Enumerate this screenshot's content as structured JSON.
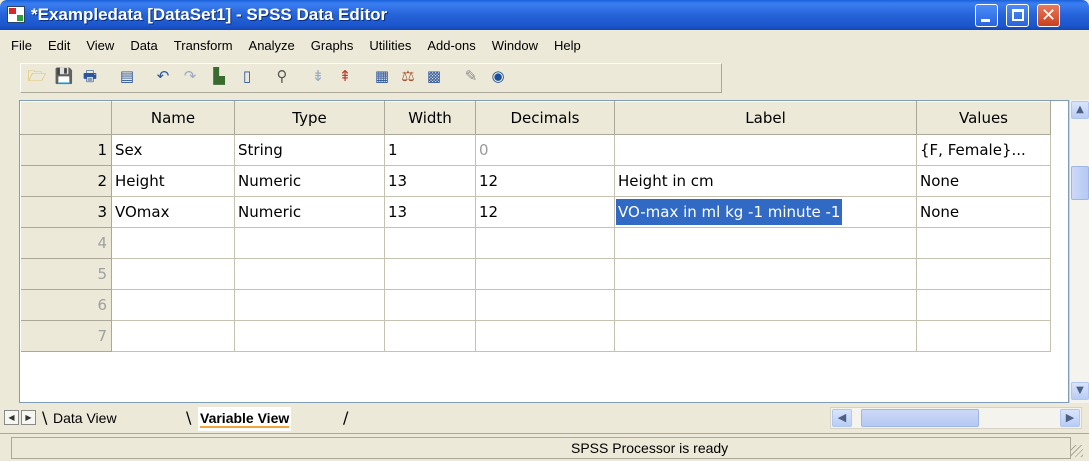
{
  "window": {
    "title": "*Exampledata [DataSet1] - SPSS Data Editor",
    "close_glyph": "✕"
  },
  "menu": [
    "File",
    "Edit",
    "View",
    "Data",
    "Transform",
    "Analyze",
    "Graphs",
    "Utilities",
    "Add-ons",
    "Window",
    "Help"
  ],
  "toolbar": {
    "icons": [
      {
        "name": "open-folder-icon",
        "glyph": "🗁"
      },
      {
        "name": "save-icon",
        "glyph": "💾"
      },
      {
        "name": "print-icon",
        "glyph": "🖶"
      },
      {
        "name": "dialog-recall-icon",
        "glyph": "▤"
      },
      {
        "name": "undo-icon",
        "glyph": "↶"
      },
      {
        "name": "redo-icon",
        "glyph": "↷"
      },
      {
        "name": "goto-case-icon",
        "glyph": "▙"
      },
      {
        "name": "variables-icon",
        "glyph": "▯"
      },
      {
        "name": "find-icon",
        "glyph": "⚲"
      },
      {
        "name": "insert-cases-icon",
        "glyph": "⇟"
      },
      {
        "name": "insert-variable-icon",
        "glyph": "⇞"
      },
      {
        "name": "split-file-icon",
        "glyph": "▦"
      },
      {
        "name": "weight-cases-icon",
        "glyph": "⚖"
      },
      {
        "name": "select-cases-icon",
        "glyph": "▩"
      },
      {
        "name": "value-labels-icon",
        "glyph": "✎"
      },
      {
        "name": "use-variable-sets-icon",
        "glyph": "◉"
      }
    ]
  },
  "grid": {
    "columns": [
      "Name",
      "Type",
      "Width",
      "Decimals",
      "Label",
      "Values"
    ],
    "rows": [
      {
        "num": "1",
        "name": "Sex",
        "type": "String",
        "width": "1",
        "decimals": "0",
        "label": "",
        "values": "{F, Female}..."
      },
      {
        "num": "2",
        "name": "Height",
        "type": "Numeric",
        "width": "13",
        "decimals": "12",
        "label": "Height in cm",
        "values": "None"
      },
      {
        "num": "3",
        "name": "VOmax",
        "type": "Numeric",
        "width": "13",
        "decimals": "12",
        "label": "VO-max in ml kg -1 minute -1",
        "values": "None"
      },
      {
        "num": "4",
        "name": "",
        "type": "",
        "width": "",
        "decimals": "",
        "label": "",
        "values": ""
      },
      {
        "num": "5",
        "name": "",
        "type": "",
        "width": "",
        "decimals": "",
        "label": "",
        "values": ""
      },
      {
        "num": "6",
        "name": "",
        "type": "",
        "width": "",
        "decimals": "",
        "label": "",
        "values": ""
      },
      {
        "num": "7",
        "name": "",
        "type": "",
        "width": "",
        "decimals": "",
        "label": "",
        "values": ""
      }
    ]
  },
  "scroll": {
    "up": "▲",
    "down": "▼",
    "left": "◀",
    "right": "▶",
    "tab_first": "◀",
    "tab_last": "▶"
  },
  "tabs": {
    "data_view": "Data View",
    "variable_view": "Variable View",
    "slash_left": "\\",
    "slash_mid": "\\",
    "slash_right": "/"
  },
  "status": {
    "text": "SPSS Processor is ready"
  }
}
